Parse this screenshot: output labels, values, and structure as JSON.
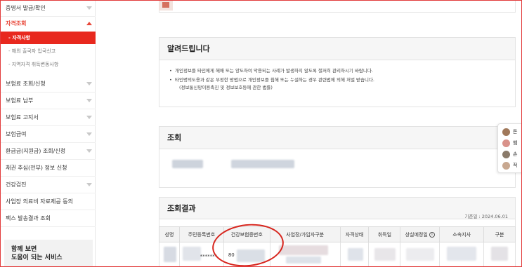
{
  "sidebar": {
    "items": [
      {
        "label": "증명서 발급/확인"
      },
      {
        "label": "자격조회"
      },
      {
        "label": "보험료 조회/신청"
      },
      {
        "label": "보험료 납부"
      },
      {
        "label": "보험료 고지서"
      },
      {
        "label": "보험급여"
      },
      {
        "label": "환급금(지원금) 조회/신청"
      },
      {
        "label": "채권 추심(전부) 정보 신청"
      },
      {
        "label": "건강검진"
      },
      {
        "label": "사업장 의료비 자료제공 동의"
      },
      {
        "label": "팩스 발송결과 조회"
      }
    ],
    "sub_items": [
      {
        "label": "- 자격사항"
      },
      {
        "label": "- 해외 출국자 입국신고"
      },
      {
        "label": "- 지역자격 취득변동사항"
      }
    ],
    "promo": {
      "line1": "함께 보면",
      "line2": "도움이 되는 서비스"
    }
  },
  "notice": {
    "title": "알려드립니다",
    "lines": [
      "개인정보를 타인에게 해애 또는 양도하여 악용되는 사례가 발생하지 않도록 철저히 관리하시기 바랍니다.",
      "타인명의도용과 같은 부정한 방법으로 개인정보를 침해 또는 누설하는 경우 관련법에 의해 처벌 받습니다.",
      "(정보통신망이용촉진 및 정보보호등에 관한 법률)"
    ]
  },
  "lookup": {
    "title": "조회"
  },
  "results": {
    "title": "조회결과",
    "date_label": "기준일 : 2024.06.01",
    "columns": [
      "성명",
      "주민등록번호",
      "건강보험증번호",
      "사업장/가입자구분",
      "자격상태",
      "취득일",
      "상실예정일",
      "소속지사",
      "구분"
    ],
    "row": {
      "rrn": "*******",
      "card_no_prefix": "80"
    }
  },
  "float_panel": {
    "rows": [
      {
        "label": "돈",
        "color": "#a0785a"
      },
      {
        "label": "햄",
        "color": "#d9928a"
      },
      {
        "label": "손",
        "color": "#8a7a6a"
      },
      {
        "label": "적",
        "color": "#c8a890"
      }
    ]
  },
  "colors": {
    "accent": "#e8281e",
    "annotation": "#d7251d"
  },
  "icons": {
    "info": "info-circle-icon",
    "chevron": "chevron-down-icon"
  }
}
